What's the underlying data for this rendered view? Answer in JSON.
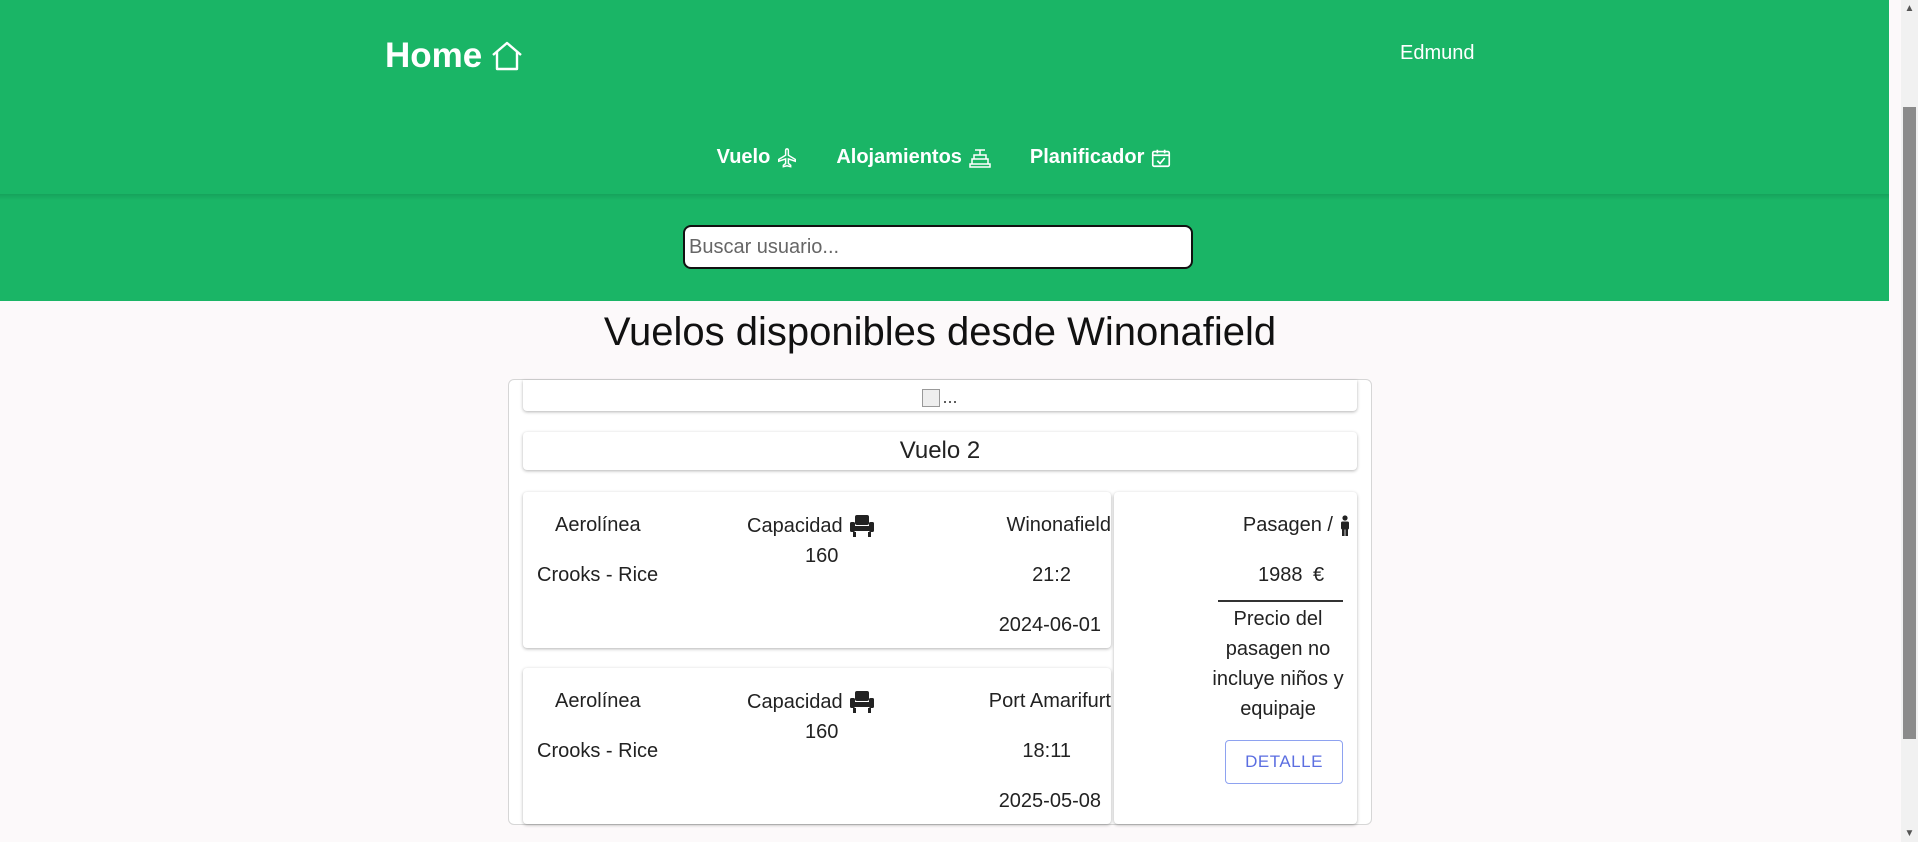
{
  "header": {
    "home_label": "Home",
    "user_name": "Edmund",
    "nav": [
      {
        "label": "Vuelo",
        "icon": "airplane-icon"
      },
      {
        "label": "Alojamientos",
        "icon": "hotel-icon"
      },
      {
        "label": "Planificador",
        "icon": "calendar-check-icon"
      }
    ],
    "search_placeholder": "Buscar usuario..."
  },
  "colors": {
    "header_bg": "#1ab566",
    "button_text": "#5b6ee1"
  },
  "main": {
    "title": "Vuelos disponibles desde Winonafield",
    "card": {
      "image_alt": "...",
      "flight_name": "Vuelo 2",
      "legs": [
        {
          "airline_label": "Aerolínea",
          "airline": "Crooks - Rice",
          "capacity_label": "Capacidad",
          "capacity": "160",
          "city": "Winonafield",
          "time": "21:2",
          "date": "2024-06-01"
        },
        {
          "airline_label": "Aerolínea",
          "airline": "Crooks - Rice",
          "capacity_label": "Capacidad",
          "capacity": "160",
          "city": "Port Amarifurt",
          "time": "18:11",
          "date": "2025-05-08"
        }
      ],
      "price": {
        "label": "Pasagen /",
        "value": "1988",
        "currency": "€",
        "note": "Precio del pasagen no incluye niños y equipaje",
        "button_label": "DETALLE"
      }
    }
  }
}
